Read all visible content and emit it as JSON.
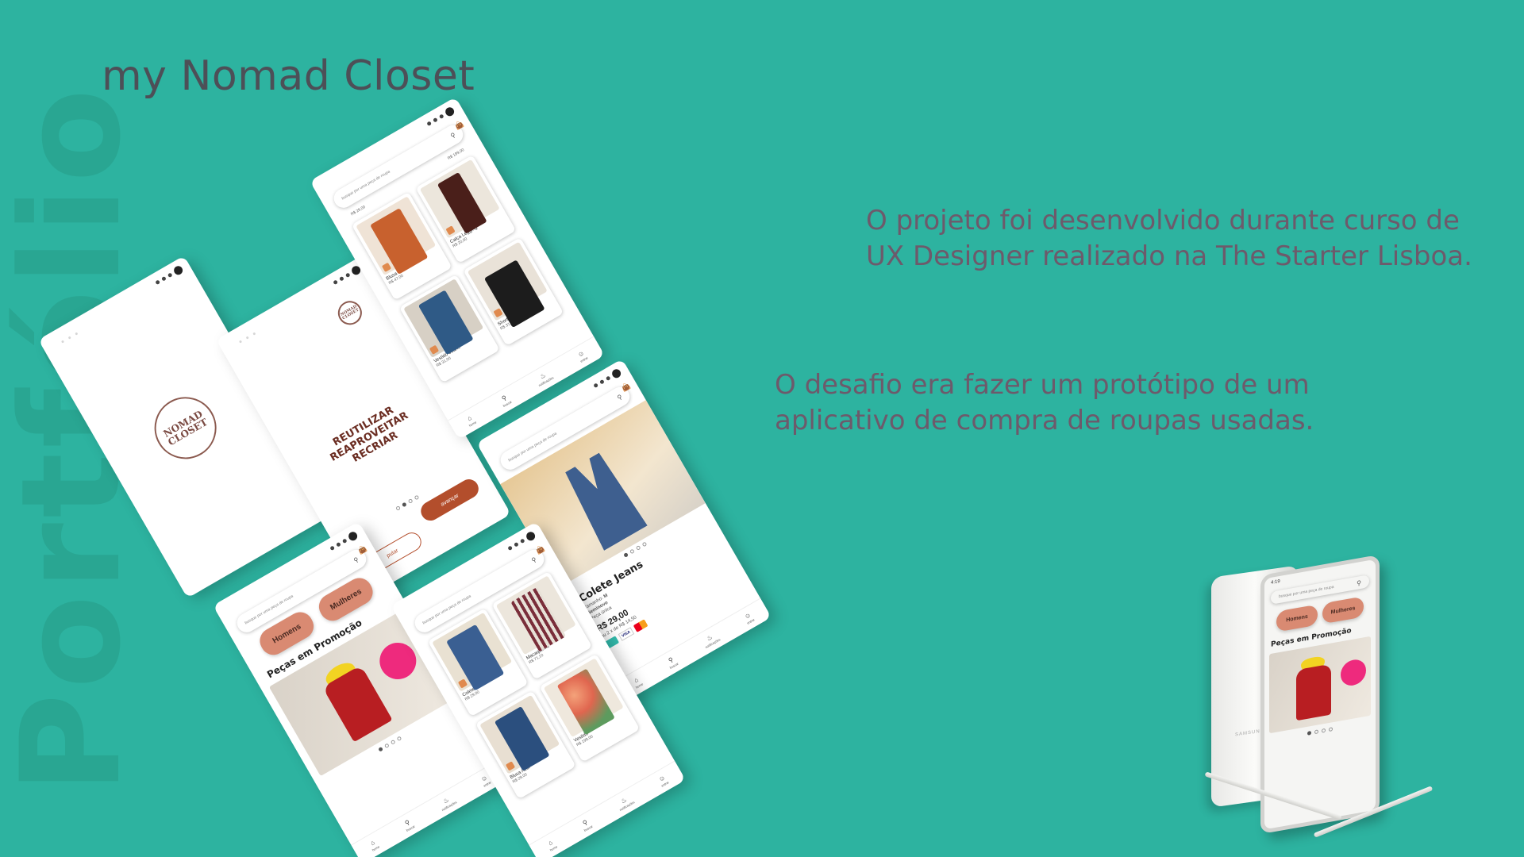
{
  "watermark": "Portfólio",
  "title": "my Nomad Closet",
  "description_1": "O projeto foi desenvolvido durante curso de UX Designer realizado na The Starter Lisboa.",
  "description_2": "O desafio era fazer um protótipo de um aplicativo  de compra de roupas usadas.",
  "colors": {
    "background": "#2db3a0",
    "accent": "#b34e2c",
    "category_pill": "#d98a72"
  },
  "logo": {
    "line1": "NOMAD",
    "line2": "CLOSET"
  },
  "onboarding": {
    "line1": "REUTILIZAR",
    "line2": "REAPROVEITAR",
    "line3": "RECRIAR",
    "skip": "pular",
    "next": "avançar"
  },
  "search": {
    "placeholder": "busque por uma peça de roupa",
    "icon": "search-icon"
  },
  "nav": {
    "home": "home",
    "search": "buscar",
    "notifications": "notificações",
    "profile": "entrar"
  },
  "listing_a": {
    "top_prices": [
      "R$ 29,00",
      "R$ 199,00"
    ],
    "items": [
      {
        "name": "Blusa Terracota",
        "price": "R$ 47,00",
        "color": "#c8612e"
      },
      {
        "name": "Calça Legging",
        "price": "R$ 20,00",
        "color": "#4a1f1a"
      },
      {
        "name": "Vestido Jeans",
        "price": "R$ 31,00",
        "color": "#2f5a86"
      },
      {
        "name": "Short",
        "price": "R$ 31,00",
        "color": "#1c1c1c"
      }
    ]
  },
  "listing_b": {
    "items": [
      {
        "name": "Colete Jeans",
        "price": "R$ 29,00",
        "color": "#3a5f92"
      },
      {
        "name": "Macaquinho",
        "price": "R$ 71,10",
        "color": "#7a2e3a"
      },
      {
        "name": "Blusa Azul",
        "price": "R$ 29,00",
        "color": "#2b4f7e"
      },
      {
        "name": "Vestido",
        "price": "R$ 199,00",
        "color": "#e0664f"
      }
    ]
  },
  "home": {
    "men": "Homens",
    "women": "Mulheres",
    "promo_title": "Peças em Promoção"
  },
  "product": {
    "name": "Colete Jeans",
    "size_label": "Tamanho:",
    "size_value": "M",
    "condition_label": "Seminovo",
    "condition_sub": "Peça única",
    "price": "R$ 29,00",
    "installments": "ou 2 x de R$ 14,50",
    "visa": "VISA"
  },
  "device": {
    "time": "4:19",
    "brand": "SAMSUNG"
  }
}
